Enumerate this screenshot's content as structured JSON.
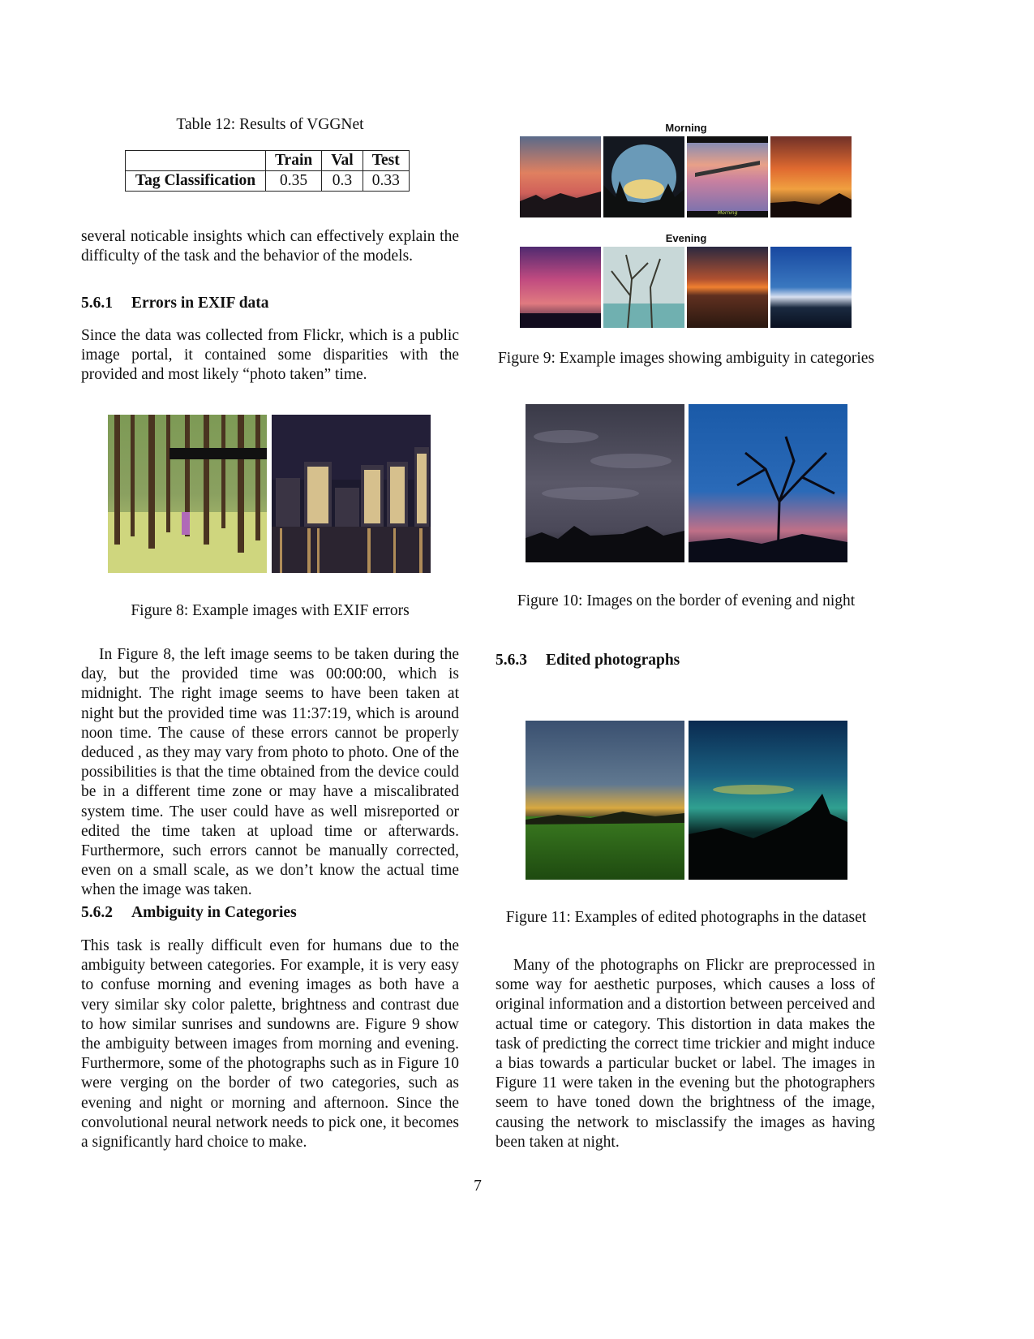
{
  "table12": {
    "caption": "Table 12: Results of VGGNet",
    "headers": [
      "",
      "Train",
      "Val",
      "Test"
    ],
    "row": [
      "Tag Classification",
      "0.35",
      "0.3",
      "0.33"
    ]
  },
  "left": {
    "intro": "several noticable insights which can effectively explain the difficulty of the task and the behavior of the models.",
    "sec561_num": "5.6.1",
    "sec561_title": "Errors in EXIF data",
    "sec561_body": "Since the data was collected from Flickr, which is a public image portal, it contained some disparities with the provided and most likely “photo taken” time.",
    "fig8_caption": "Figure 8: Example images with EXIF errors",
    "para_fig8": "In Figure 8, the left image seems to be taken during the day, but the provided time was 00:00:00, which is midnight. The right image seems to have been taken at night but the provided time was 11:37:19, which is around noon time. The cause of these errors cannot be properly deduced , as they may vary from photo to photo. One of the possibilities is that the time obtained from the device could be in a different time zone or may have a miscalibrated system time. The user could have as well misreported or edited the time taken at upload time or afterwards. Furthermore, such errors cannot be manually corrected, even on a small scale, as we don’t know the actual time when the image was taken.",
    "sec562_num": "5.6.2",
    "sec562_title": "Ambiguity in Categories",
    "sec562_body": "This task is really difficult even for humans due to the ambiguity between categories. For example, it is very easy to confuse morning and evening images as both have a very similar sky color palette, brightness and contrast due to how similar sunrises and sundowns are. Figure 9 show the ambiguity between images from morning and evening. Furthermore, some of the photographs such as in Figure 10 were verging on the border of two categories, such as evening and night or morning and afternoon. Since the convolutional neural network needs to pick one, it becomes a significantly hard choice to make."
  },
  "right": {
    "fig9_label_morning": "Morning",
    "fig9_label_evening": "Evening",
    "fig9_inner_tag": "Morning",
    "fig9_caption": "Figure 9: Example images showing ambiguity in categories",
    "fig10_caption": "Figure 10: Images on the border of evening and night",
    "sec563_num": "5.6.3",
    "sec563_title": "Edited photographs",
    "fig11_caption": "Figure 11: Examples of edited photographs in the dataset",
    "para_edit": "Many of the photographs on Flickr are preprocessed in some way for aesthetic purposes, which causes a loss of original information and a distortion between perceived and actual time or category. This distortion in data makes the task of predicting the correct time trickier and might induce a bias towards a particular bucket or label. The images in Figure 11 were taken in the evening but the photographers seem to have toned down the brightness of the image, causing the network to misclassify the images as having been taken at night."
  },
  "page_number": "7"
}
